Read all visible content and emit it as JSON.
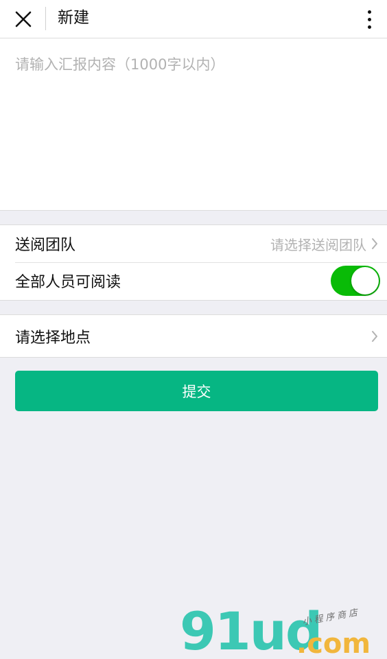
{
  "header": {
    "title": "新建"
  },
  "report": {
    "placeholder": "请输入汇报内容（1000字以内）",
    "value": ""
  },
  "team": {
    "label": "送阅团队",
    "placeholder": "请选择送阅团队"
  },
  "readable": {
    "label": "全部人员可阅读",
    "enabled": true
  },
  "location": {
    "label": "请选择地点"
  },
  "submit": {
    "label": "提交"
  },
  "watermark": {
    "main": "91ud",
    "domain": ".com",
    "tagline": "小程序商店"
  },
  "colors": {
    "background": "#efeff4",
    "switch_on": "#09bb07",
    "submit_button": "#06b683",
    "placeholder": "#b2b2b2"
  },
  "icons": {
    "close": "close-icon",
    "more": "more-vertical-icon",
    "chevron": "chevron-right-icon"
  }
}
